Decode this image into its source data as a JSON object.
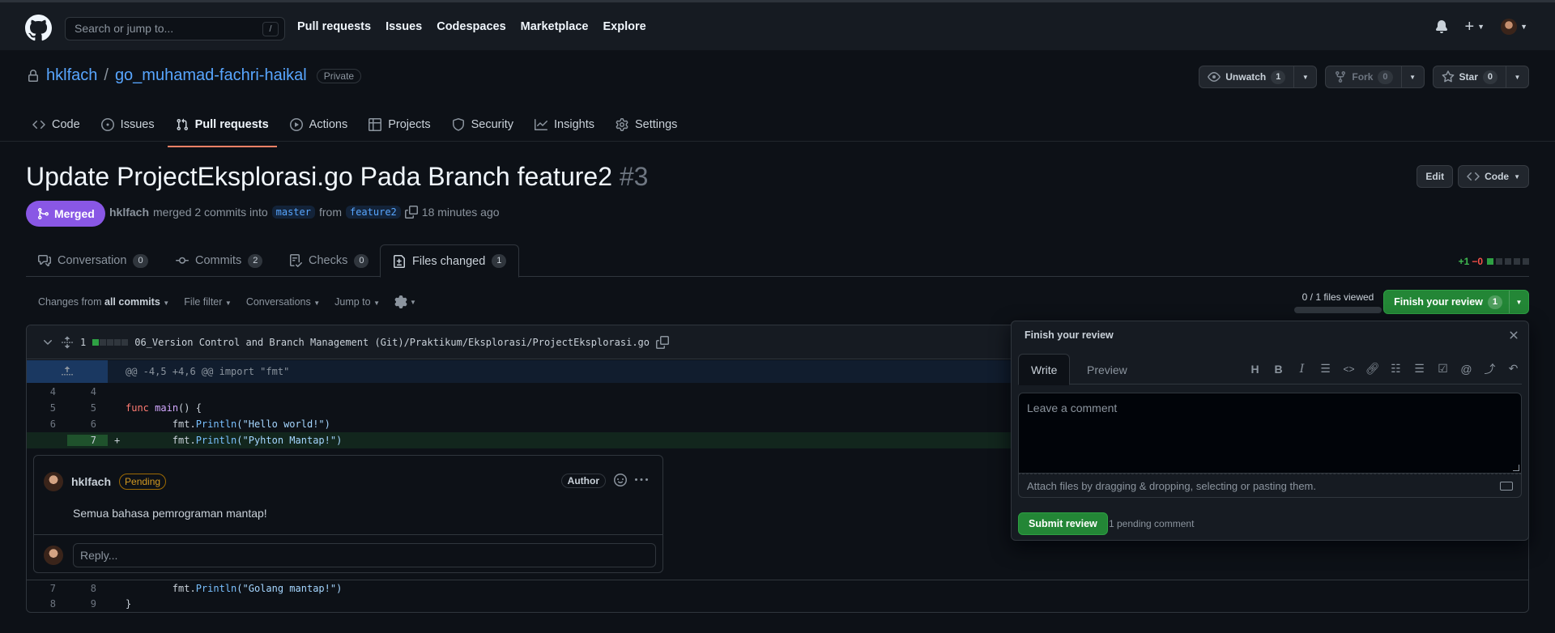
{
  "header": {
    "search_placeholder": "Search or jump to...",
    "search_shortcut": "/",
    "nav": [
      "Pull requests",
      "Issues",
      "Codespaces",
      "Marketplace",
      "Explore"
    ],
    "plus_label": "+"
  },
  "repo": {
    "owner": "hklfach",
    "separator": "/",
    "name": "go_muhamad-fachri-haikal",
    "visibility": "Private",
    "unwatch_label": "Unwatch",
    "watch_count": "1",
    "fork_label": "Fork",
    "fork_count": "0",
    "star_label": "Star",
    "star_count": "0",
    "tabs": [
      {
        "label": "Code",
        "icon": "code-icon"
      },
      {
        "label": "Issues",
        "icon": "issue-icon"
      },
      {
        "label": "Pull requests",
        "icon": "pull-request-icon"
      },
      {
        "label": "Actions",
        "icon": "play-icon"
      },
      {
        "label": "Projects",
        "icon": "table-icon"
      },
      {
        "label": "Security",
        "icon": "shield-icon"
      },
      {
        "label": "Insights",
        "icon": "graph-icon"
      },
      {
        "label": "Settings",
        "icon": "gear-icon"
      }
    ]
  },
  "pr": {
    "title": "Update ProjectEksplorasi.go Pada Branch feature2",
    "number": "#3",
    "edit_label": "Edit",
    "code_label": "Code",
    "state": "Merged",
    "author": "hklfach",
    "merged_text": "merged 2 commits into",
    "base_branch": "master",
    "from_text": "from",
    "head_branch": "feature2",
    "time_ago": "18 minutes ago",
    "tabs": [
      {
        "label": "Conversation",
        "count": "0"
      },
      {
        "label": "Commits",
        "count": "2"
      },
      {
        "label": "Checks",
        "count": "0"
      },
      {
        "label": "Files changed",
        "count": "1"
      }
    ],
    "additions": "+1",
    "deletions": "−0"
  },
  "toolbar": {
    "changes_from": "Changes from",
    "all_commits": "all commits",
    "file_filter": "File filter",
    "conversations": "Conversations",
    "jump_to": "Jump to",
    "files_viewed": "0 / 1 files viewed",
    "files_viewed_fraction": 0,
    "finish_review": "Finish your review",
    "finish_count": "1"
  },
  "file": {
    "change_count": "1",
    "path": "06_Version Control and Branch Management (Git)/Praktikum/Eksplorasi/ProjectEksplorasi.go",
    "hunk": "@@ -4,5 +4,6 @@ import \"fmt\"",
    "lines_before": [
      {
        "old": "4",
        "new": "4",
        "code": ""
      },
      {
        "old": "5",
        "new": "5",
        "kw": "func",
        "name": "main",
        "rest": "() {"
      },
      {
        "old": "6",
        "new": "6",
        "indent": "        ",
        "pkg": "fmt.",
        "call": "Println",
        "str": "(\"Hello world!\")"
      },
      {
        "old": "",
        "new": "7",
        "sign": "+",
        "indent": "        ",
        "pkg": "fmt.",
        "call": "Println",
        "str": "(\"Pyhton Mantap!\")"
      }
    ],
    "lines_after": [
      {
        "old": "7",
        "new": "8",
        "indent": "        ",
        "pkg": "fmt.",
        "call": "Println",
        "str": "(\"Golang mantap!\")"
      },
      {
        "old": "8",
        "new": "9",
        "code": "}"
      }
    ]
  },
  "comment": {
    "author": "hklfach",
    "status": "Pending",
    "role": "Author",
    "body": "Semua bahasa pemrograman mantap!",
    "reply_placeholder": "Reply..."
  },
  "review": {
    "title": "Finish your review",
    "tab_write": "Write",
    "tab_preview": "Preview",
    "placeholder": "Leave a comment",
    "attach_text": "Attach files by dragging & dropping, selecting or pasting them.",
    "submit_label": "Submit review",
    "pending_text": "1 pending comment",
    "tools": [
      "heading-icon",
      "bold-icon",
      "italic-icon",
      "quote-icon",
      "code-icon",
      "link-icon",
      "bulleted-list-icon",
      "numbered-list-icon",
      "task-list-icon",
      "mention-icon",
      "reference-icon",
      "undo-icon"
    ]
  },
  "colors": {
    "merged": "#8957e5",
    "accent": "#58a6ff",
    "primary_button": "#238636",
    "tab_underline": "#f78166"
  }
}
